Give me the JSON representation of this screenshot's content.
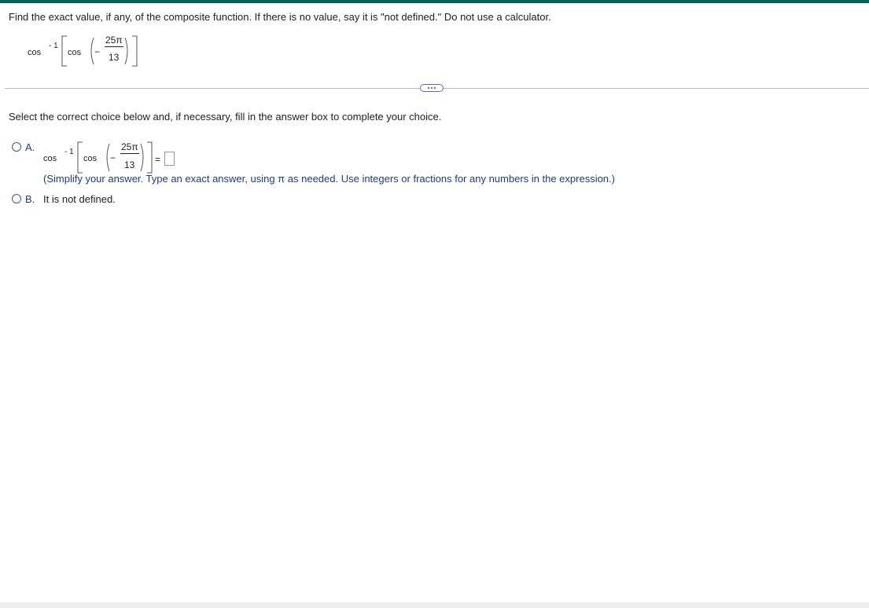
{
  "question": {
    "prompt": "Find the exact value, if any, of the composite function. If there is no value, say it is \"not defined.\" Do not use a calculator.",
    "expression": {
      "outer_fn": "cos",
      "exponent": "- 1",
      "inner_fn": "cos",
      "sign": "−",
      "numerator": "25π",
      "denominator": "13"
    }
  },
  "more_button": {
    "label": "..."
  },
  "instruction": "Select the correct choice below and, if necessary, fill in the answer box to complete your choice.",
  "choices": [
    {
      "letter": "A.",
      "expression": {
        "outer_fn": "cos",
        "exponent": "- 1",
        "inner_fn": "cos",
        "sign": "−",
        "numerator": "25π",
        "denominator": "13",
        "equals": "="
      },
      "answer_value": "",
      "note": "(Simplify your answer. Type an exact answer, using π as needed. Use integers or fractions for any numbers in the expression.)"
    },
    {
      "letter": "B.",
      "text": "It is not defined."
    }
  ]
}
